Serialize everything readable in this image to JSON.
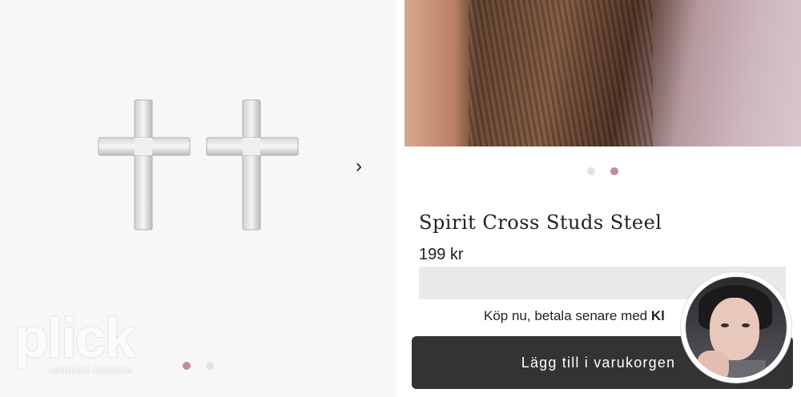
{
  "gallery": {
    "next_icon": "chevron-right-icon",
    "dots": [
      {
        "active": true
      },
      {
        "active": false
      }
    ]
  },
  "photo_gallery": {
    "dots": [
      {
        "active": false
      },
      {
        "active": true
      }
    ]
  },
  "product": {
    "title": "Spirit Cross Studs Steel",
    "price": "199 kr"
  },
  "payment": {
    "text": "Köp nu, betala senare med",
    "brand": "Kl"
  },
  "cart": {
    "button_label": "Lägg till i varukorgen"
  },
  "watermark": {
    "logo": "plick",
    "tagline": "reloved fashion"
  },
  "colors": {
    "accent": "#c48aa0",
    "button": "#333333"
  }
}
